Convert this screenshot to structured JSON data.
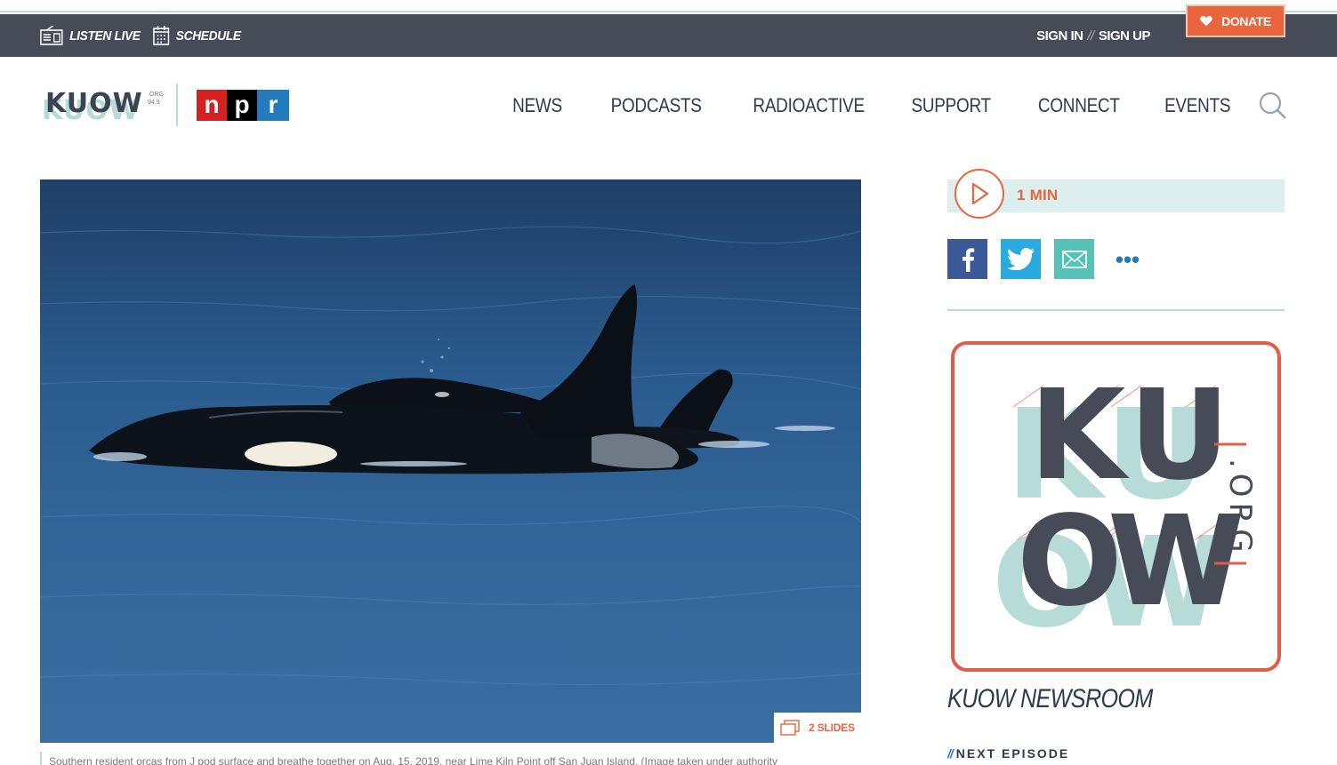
{
  "utility_bar": {
    "listen_live": "LISTEN LIVE",
    "schedule": "SCHEDULE",
    "sign_in": "SIGN IN",
    "separator": "//",
    "sign_up": "SIGN UP",
    "donate": "DONATE"
  },
  "header": {
    "logo_wordmark": "KUOW",
    "logo_suffix": ".ORG",
    "logo_freq": "94.9",
    "npr_letters": [
      "n",
      "p",
      "r"
    ],
    "nav": [
      "NEWS",
      "PODCASTS",
      "RADIOACTIVE",
      "SUPPORT",
      "CONNECT",
      "EVENTS"
    ]
  },
  "hero": {
    "slides_label": "2 SLIDES",
    "caption": "Southern resident orcas from J pod surface and breathe together on Aug. 15, 2019, near Lime Kiln Point off San Juan Island. (Image taken under authority"
  },
  "audio": {
    "duration": "1 MIN"
  },
  "share": {
    "more": "•••"
  },
  "show": {
    "art_letters": [
      "K",
      "U",
      "O",
      "W"
    ],
    "art_domain": ".ORG",
    "title": "KUOW NEWSROOM",
    "next_prefix": "//",
    "next_label": "NEXT EPISODE"
  },
  "colors": {
    "utility_bg": "#464b57",
    "accent": "#e8653e",
    "teal": "#b7dcd8",
    "navy": "#2e3a4d",
    "facebook": "#3b5998",
    "twitter": "#29aae1",
    "email": "#56c1b7"
  },
  "icons": {
    "listen": "radio-icon",
    "schedule": "calendar-icon",
    "donate": "heart-icon",
    "search": "search-icon",
    "play": "play-icon",
    "slides": "slides-icon",
    "facebook": "facebook-icon",
    "twitter": "twitter-icon",
    "email": "email-icon",
    "more": "more-icon"
  }
}
